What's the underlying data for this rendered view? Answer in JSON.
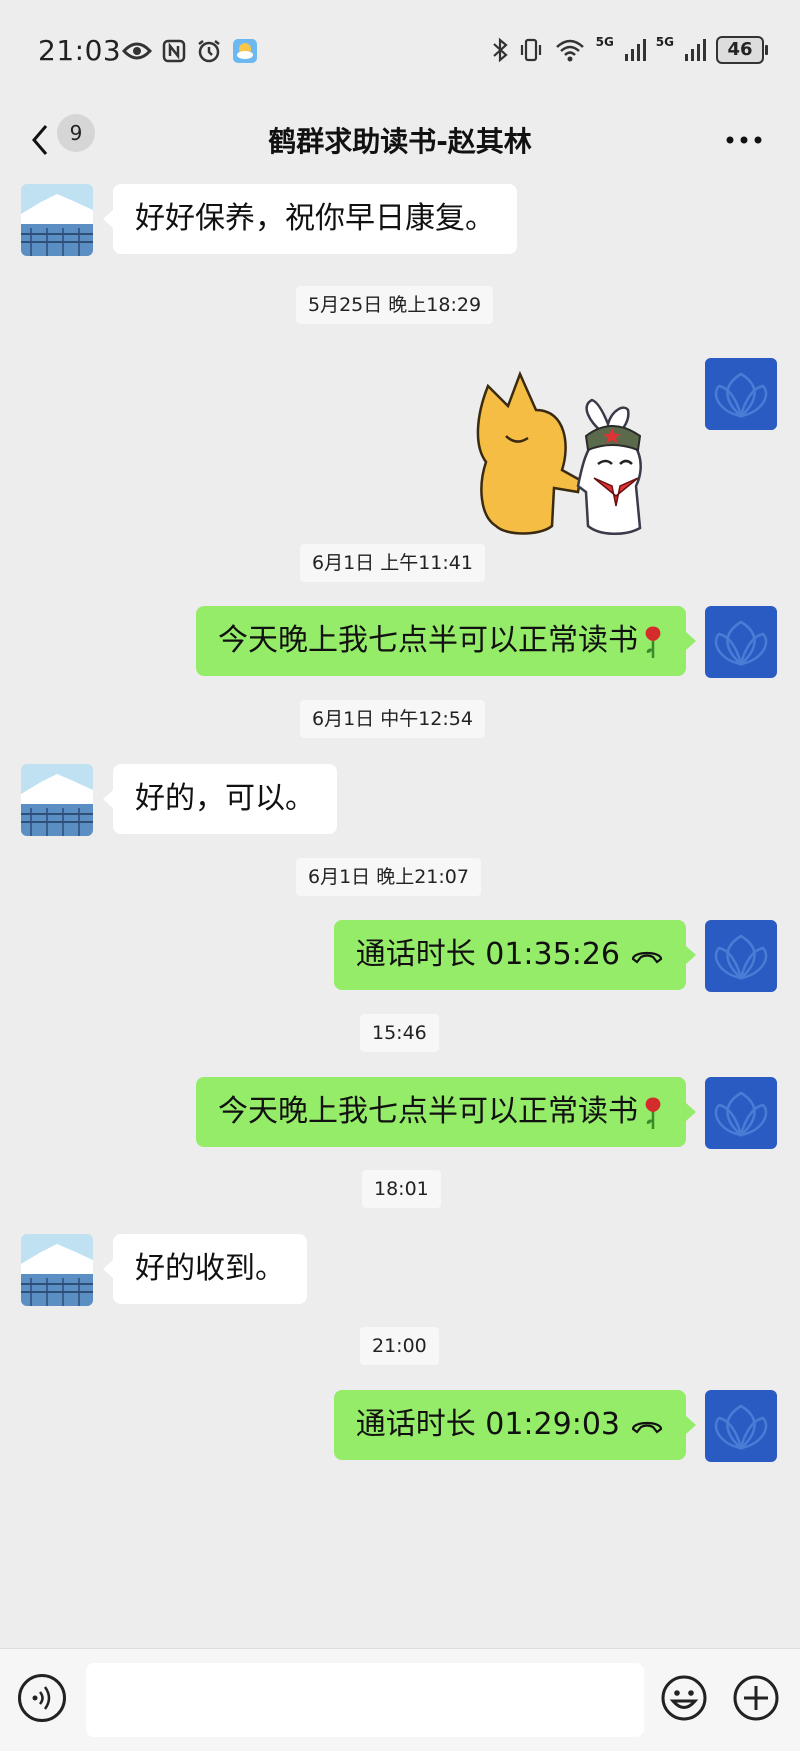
{
  "status_bar": {
    "time": "21:03",
    "battery": "46",
    "net1": "5G",
    "net2": "5G",
    "icons": [
      "eye-icon",
      "nfc-icon",
      "alarm-icon",
      "weather-icon",
      "bluetooth-icon",
      "vibrate-icon",
      "wifi-icon",
      "signal-icon",
      "signal-icon",
      "battery-icon"
    ]
  },
  "header": {
    "unread_count": "9",
    "title": "鹤群求助读书-赵其林"
  },
  "messages": [
    {
      "type": "text",
      "side": "left",
      "text": "好好保养，祝你早日康复。"
    },
    {
      "type": "time",
      "text": "5月25日 晚上18:29"
    },
    {
      "type": "sticker",
      "side": "right",
      "icon": "handshake-sticker"
    },
    {
      "type": "time",
      "text": "6月1日 上午11:41"
    },
    {
      "type": "text",
      "side": "right",
      "text": "今天晚上我七点半可以正常读书"
    },
    {
      "type": "time",
      "text": "6月1日 中午12:54"
    },
    {
      "type": "text",
      "side": "left",
      "text": "好的，可以。"
    },
    {
      "type": "time",
      "text": "6月1日 晚上21:07"
    },
    {
      "type": "call",
      "side": "right",
      "text": "通话时长 01:35:26"
    },
    {
      "type": "time",
      "text": "15:46"
    },
    {
      "type": "text",
      "side": "right",
      "text": "今天晚上我七点半可以正常读书"
    },
    {
      "type": "time",
      "text": "18:01"
    },
    {
      "type": "text",
      "side": "left",
      "text": "好的收到。"
    },
    {
      "type": "time",
      "text": "21:00"
    },
    {
      "type": "call",
      "side": "right",
      "text": "通话时长 01:29:03"
    }
  ],
  "colors": {
    "background": "#ededed",
    "outgoing_bubble": "#95ec69",
    "incoming_bubble": "#ffffff",
    "self_avatar": "#2255bb"
  }
}
